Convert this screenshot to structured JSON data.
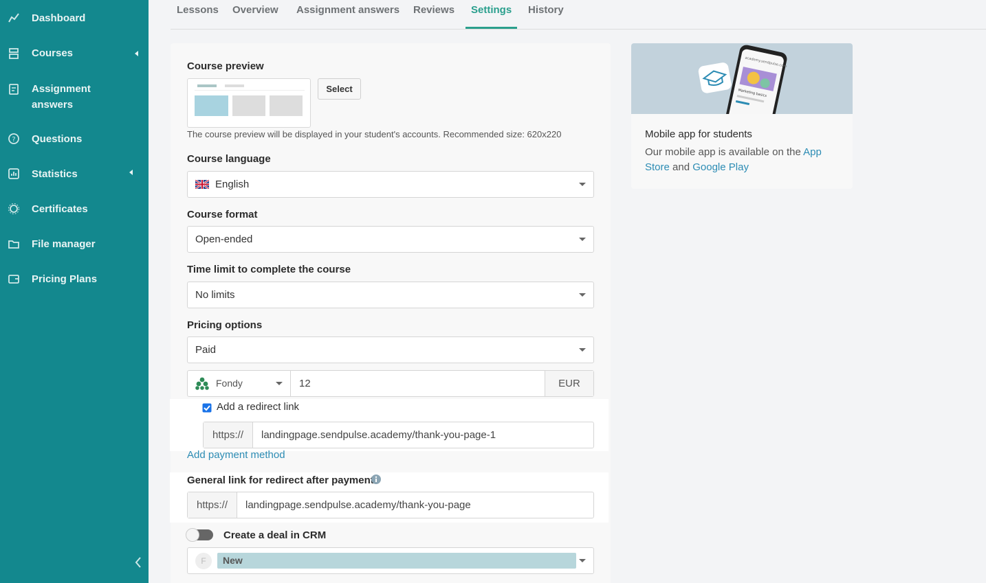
{
  "sidebar": {
    "items": [
      {
        "label": "Dashboard",
        "icon": "chart-line-icon"
      },
      {
        "label": "Courses",
        "icon": "courses-icon"
      },
      {
        "label": "Assignment answers",
        "icon": "assignment-icon"
      },
      {
        "label": "Questions",
        "icon": "question-icon"
      },
      {
        "label": "Statistics",
        "icon": "statistics-icon"
      },
      {
        "label": "Certificates",
        "icon": "certificate-icon"
      },
      {
        "label": "File manager",
        "icon": "folder-icon"
      },
      {
        "label": "Pricing Plans",
        "icon": "wallet-icon"
      }
    ],
    "colors": {
      "background": "#13888e",
      "text": "#e9f4f4"
    }
  },
  "tabs": [
    {
      "label": "Lessons"
    },
    {
      "label": "Overview"
    },
    {
      "label": "Assignment answers"
    },
    {
      "label": "Reviews"
    },
    {
      "label": "Settings",
      "active": true
    },
    {
      "label": "History"
    }
  ],
  "form": {
    "course_preview": {
      "label": "Course preview",
      "button": "Select",
      "hint": "The course preview will be displayed in your student's accounts. Recommended size: 620x220"
    },
    "course_language": {
      "label": "Course language",
      "value": "English",
      "flag": "uk-flag-icon"
    },
    "course_format": {
      "label": "Course format",
      "value": "Open-ended"
    },
    "time_limit": {
      "label": "Time limit to complete the course",
      "value": "No limits"
    },
    "pricing": {
      "label": "Pricing options",
      "value": "Paid"
    },
    "payment": {
      "provider": "Fondy",
      "amount": "12",
      "currency": "EUR",
      "redirect_checkbox_label": "Add a redirect link",
      "redirect_checked": true,
      "redirect_prefix": "https://",
      "redirect_url": "landingpage.sendpulse.academy/thank-you-page-1",
      "add_method": "Add payment method"
    },
    "general_redirect": {
      "label": "General link for redirect after payment",
      "prefix": "https://",
      "url": "landingpage.sendpulse.academy/thank-you-page"
    },
    "crm": {
      "label": "Create a deal in CRM",
      "enabled": false,
      "stage": "New",
      "avatar_letter": "F"
    }
  },
  "side_card": {
    "title": "Mobile app for students",
    "text_before": "Our mobile app is available on the ",
    "app_store": "App Store",
    "and": " and ",
    "google_play": "Google Play",
    "phone_url": "academy.sendpulse.com",
    "phone_caption": "Marketing basics"
  },
  "colors": {
    "accent": "#2a9f8d",
    "link": "#2c8cb4",
    "checkbox": "#1a73e8"
  }
}
